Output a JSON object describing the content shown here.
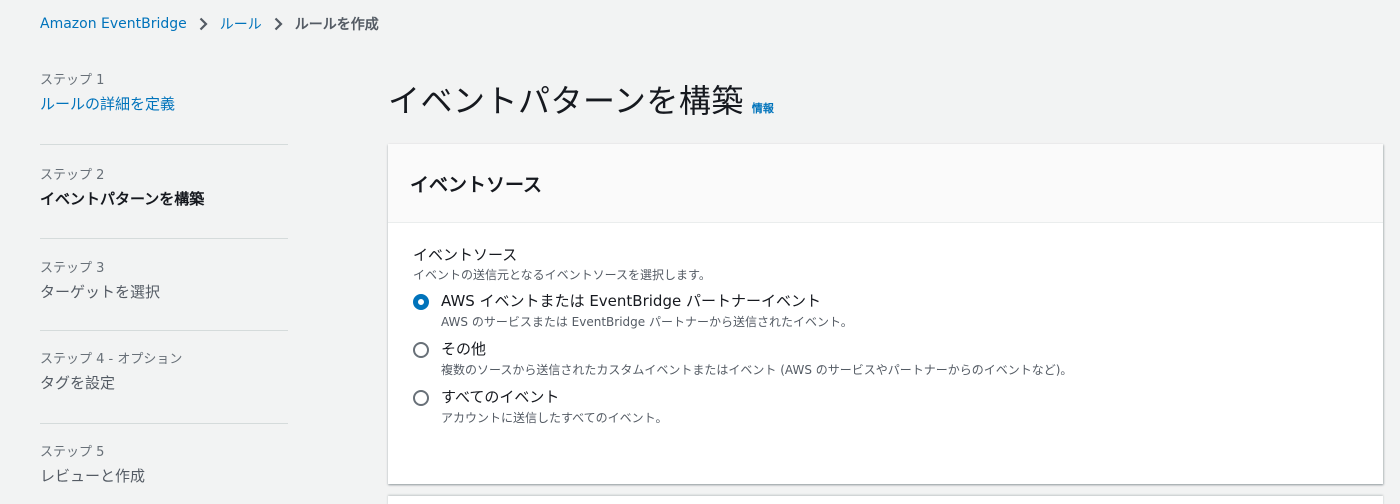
{
  "breadcrumb": {
    "items": [
      "Amazon EventBridge",
      "ルール"
    ],
    "current": "ルールを作成"
  },
  "steps": [
    {
      "num": "ステップ 1",
      "title": "ルールの詳細を定義",
      "state": "link"
    },
    {
      "num": "ステップ 2",
      "title": "イベントパターンを構築",
      "state": "active"
    },
    {
      "num": "ステップ 3",
      "title": "ターゲットを選択",
      "state": "disabled"
    },
    {
      "num": "ステップ 4 - オプション",
      "title": "タグを設定",
      "state": "disabled"
    },
    {
      "num": "ステップ 5",
      "title": "レビューと作成",
      "state": "disabled"
    }
  ],
  "page": {
    "title": "イベントパターンを構築",
    "info": "情報"
  },
  "panel": {
    "header": "イベントソース",
    "field_label": "イベントソース",
    "field_desc": "イベントの送信元となるイベントソースを選択します。",
    "options": [
      {
        "label": "AWS イベントまたは EventBridge パートナーイベント",
        "desc": "AWS のサービスまたは EventBridge パートナーから送信されたイベント。",
        "checked": true
      },
      {
        "label": "その他",
        "desc": "複数のソースから送信されたカスタムイベントまたはイベント (AWS のサービスやパートナーからのイベントなど)。",
        "checked": false
      },
      {
        "label": "すべてのイベント",
        "desc": "アカウントに送信したすべてのイベント。",
        "checked": false
      }
    ]
  },
  "colors": {
    "link": "#0073bb",
    "background": "#f2f3f3",
    "panel": "#ffffff"
  }
}
